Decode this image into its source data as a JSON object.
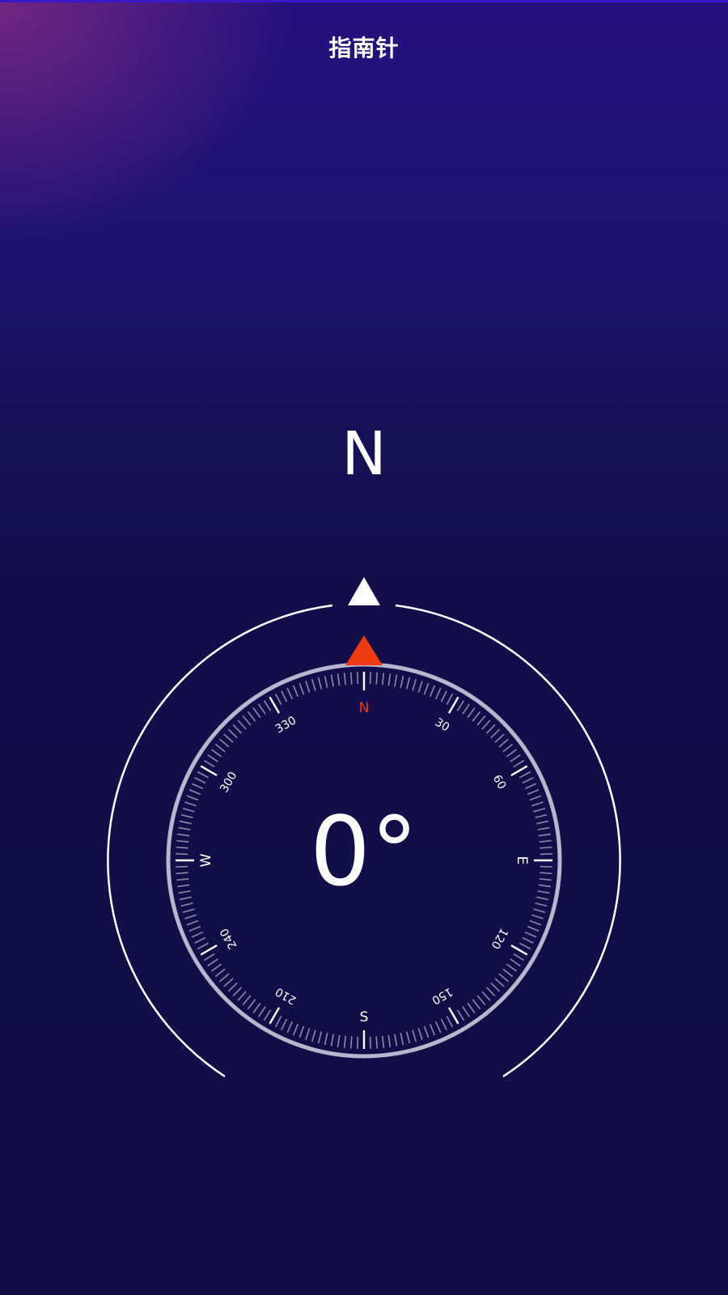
{
  "app": {
    "title": "指南针"
  },
  "heading": {
    "direction": "N",
    "degrees": "0°"
  },
  "dial": {
    "cardinals": {
      "north": "N",
      "east": "E",
      "south": "S",
      "west": "W"
    },
    "degree_labels": [
      "30",
      "60",
      "120",
      "150",
      "210",
      "240",
      "300",
      "330"
    ]
  },
  "colors": {
    "north_marker": "#ee3b12",
    "heading_marker": "#ffffff",
    "ring": "#b8b5cf",
    "background_top": "#25117e",
    "background_bottom": "#120d44"
  },
  "icons": {
    "heading_pointer": "triangle-up-icon",
    "north_pointer": "triangle-up-icon"
  }
}
